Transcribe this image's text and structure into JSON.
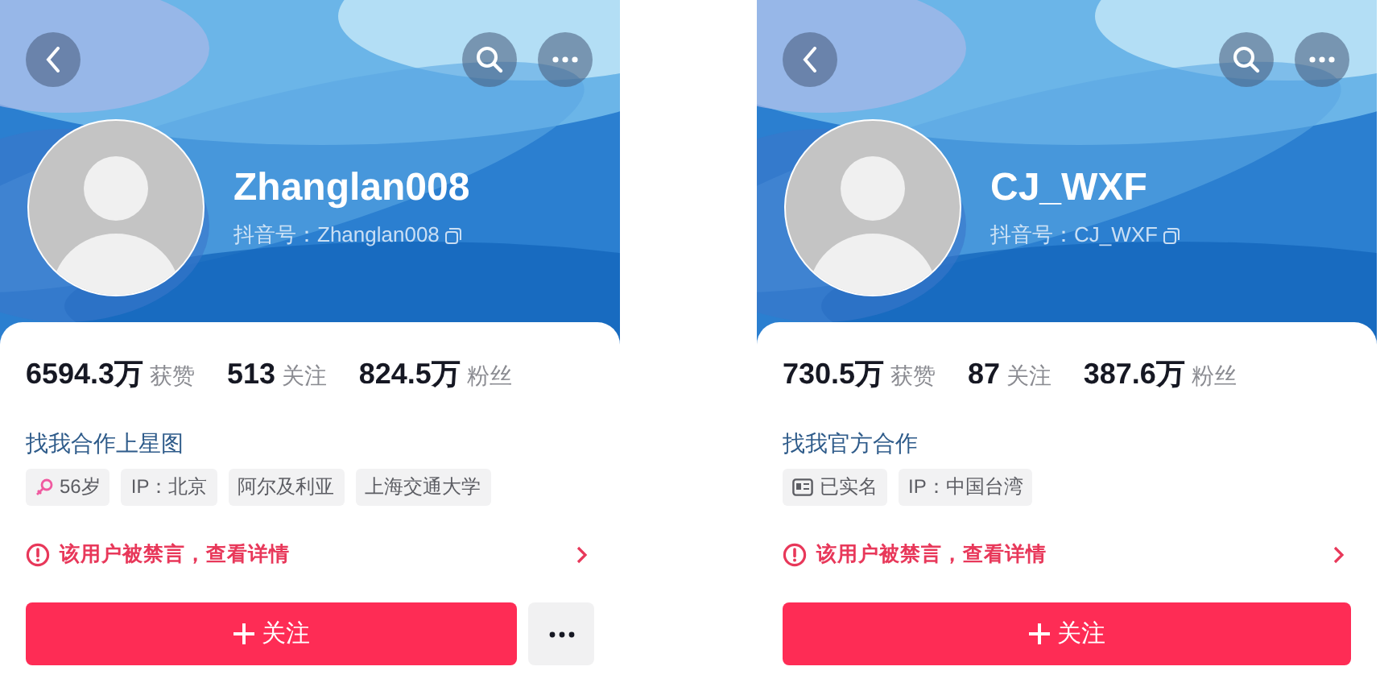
{
  "profiles": [
    {
      "username": "Zhanglan008",
      "douyin_id": "抖音号：Zhanglan008",
      "stats": [
        "**6594.3万** 获赞",
        "**513** 关注",
        "**824.5万** 粉丝"
      ],
      "link": "找我合作上星图",
      "tags": [
        {
          "kind": "gender",
          "text": "56岁"
        },
        {
          "kind": "plain",
          "text": "IP：北京"
        },
        {
          "kind": "plain",
          "text": "阿尔及利亚"
        },
        {
          "kind": "plain",
          "text": "上海交通大学"
        }
      ],
      "notice": "该用户被禁言，查看详情",
      "follow_label": "关注",
      "more_button": true
    },
    {
      "username": "CJ_WXF",
      "douyin_id": "抖音号：CJ_WXF",
      "stats": [
        "**730.5万** 获赞",
        "**87** 关注",
        "**387.6万** 粉丝"
      ],
      "link": "找我官方合作",
      "tags": [
        {
          "kind": "verified",
          "text": "已实名"
        },
        {
          "kind": "plain",
          "text": "IP：中国台湾"
        }
      ],
      "notice": "该用户被禁言，查看详情",
      "follow_label": "关注",
      "more_button": false
    }
  ]
}
